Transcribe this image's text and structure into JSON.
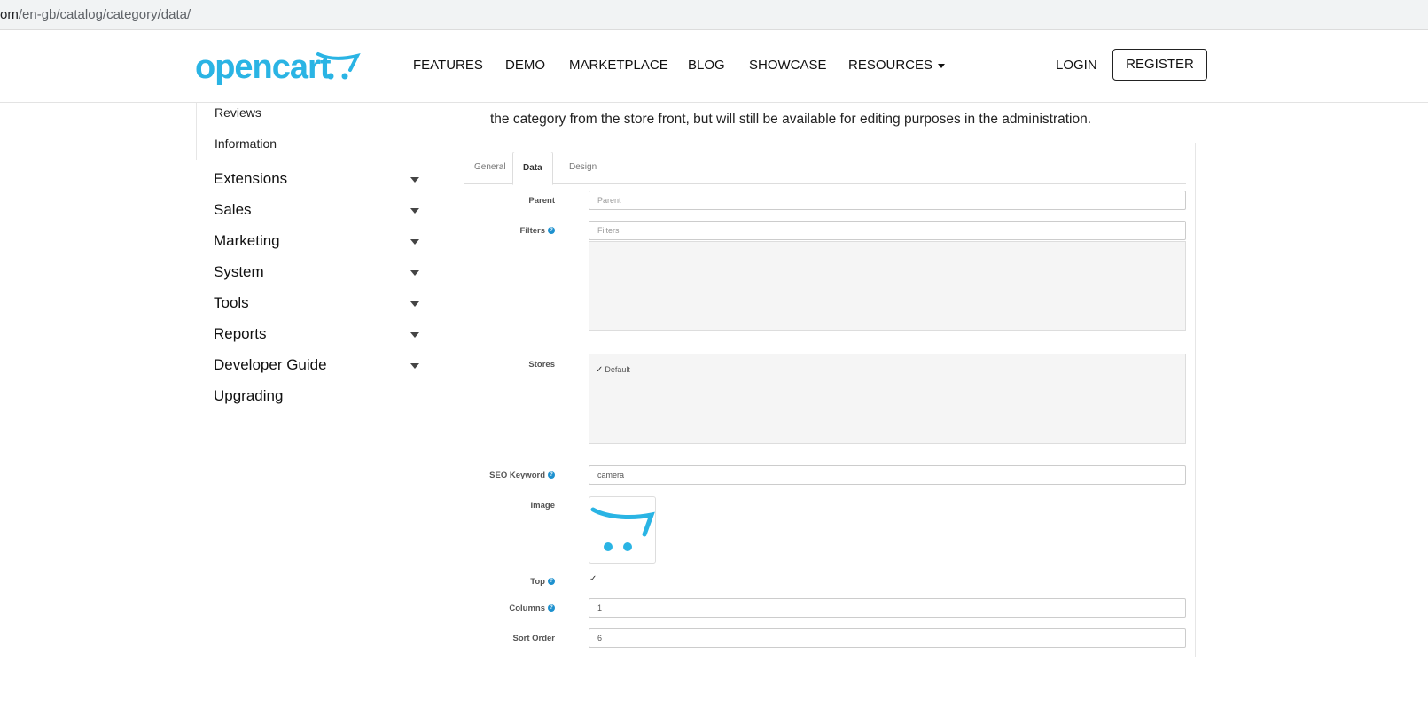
{
  "browser": {
    "url_prefix": "om",
    "url_path": "/en-gb/catalog/category/data/"
  },
  "header": {
    "logo_text": "opencart",
    "nav": [
      "FEATURES",
      "DEMO",
      "MARKETPLACE",
      "BLOG",
      "SHOWCASE",
      "RESOURCES"
    ],
    "login": "LOGIN",
    "register": "REGISTER"
  },
  "sidebar": {
    "sub_items": [
      "Reviews",
      "Information"
    ],
    "items": [
      "Extensions",
      "Sales",
      "Marketing",
      "System",
      "Tools",
      "Reports",
      "Developer Guide",
      "Upgrading"
    ]
  },
  "main": {
    "intro": "the category from the store front, but will still be available for editing purposes in the administration.",
    "tabs": [
      "General",
      "Data",
      "Design"
    ],
    "active_tab": "Data",
    "form": {
      "parent_label": "Parent",
      "parent_placeholder": "Parent",
      "filters_label": "Filters",
      "filters_placeholder": "Filters",
      "stores_label": "Stores",
      "stores_option": "Default",
      "seo_label": "SEO Keyword",
      "seo_value": "camera",
      "image_label": "Image",
      "top_label": "Top",
      "columns_label": "Columns",
      "columns_value": "1",
      "sort_label": "Sort Order",
      "sort_value": "6"
    }
  },
  "colors": {
    "brand": "#2ab4e4",
    "help_icon": "#1e91cf"
  }
}
